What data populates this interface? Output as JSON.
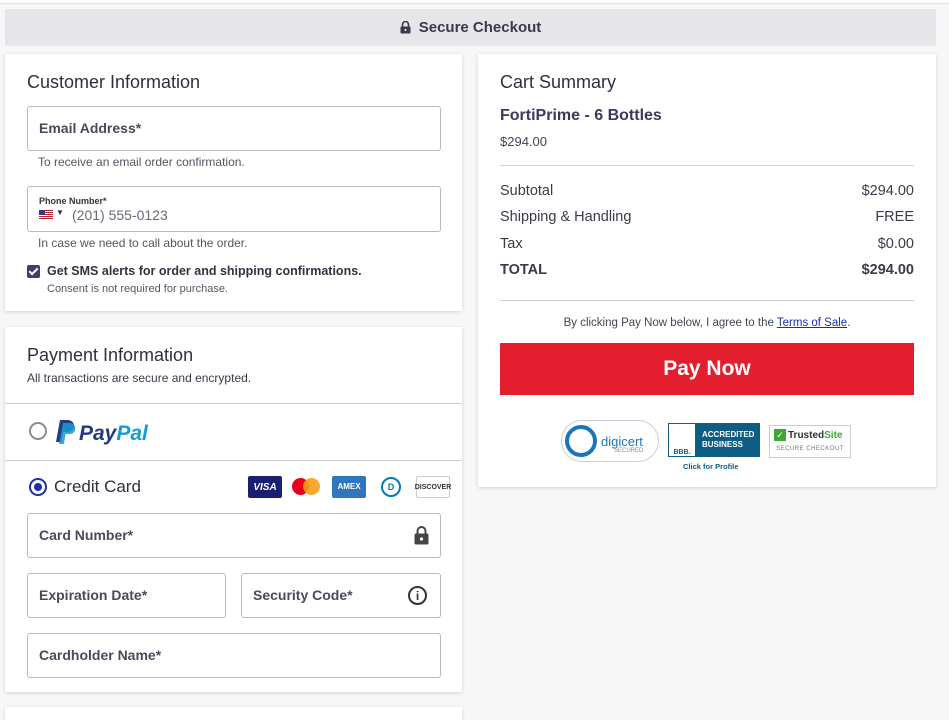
{
  "header": {
    "secure_checkout": "Secure Checkout",
    "lock_icon": "lock-icon"
  },
  "customer": {
    "title": "Customer Information",
    "email_label": "Email Address*",
    "email_helper": "To receive an email order confirmation.",
    "phone_label": "Phone Number*",
    "phone_country": "US",
    "phone_placeholder": "(201) 555-0123",
    "phone_helper": "In case we need to call about the order.",
    "sms_label": "Get SMS alerts for order and shipping confirmations.",
    "sms_checked": true,
    "consent": "Consent is not required for purchase."
  },
  "payment": {
    "title": "Payment Information",
    "subtitle": "All transactions are secure and encrypted.",
    "paypal_pay": "Pay",
    "paypal_pal": "Pal",
    "credit_card_label": "Credit Card",
    "selected_method": "credit-card",
    "card_brands": [
      "VISA",
      "Mastercard",
      "AMEX",
      "Diners Club",
      "DISCOVER"
    ],
    "card_number_label": "Card Number*",
    "expiration_label": "Expiration Date*",
    "security_code_label": "Security Code*",
    "cardholder_label": "Cardholder Name*"
  },
  "cart": {
    "title": "Cart Summary",
    "product_name": "FortiPrime - 6 Bottles",
    "product_price": "$294.00",
    "rows": [
      {
        "label": "Subtotal",
        "value": "$294.00"
      },
      {
        "label": "Shipping & Handling",
        "value": "FREE"
      },
      {
        "label": "Tax",
        "value": "$0.00"
      },
      {
        "label": "TOTAL",
        "value": "$294.00"
      }
    ],
    "terms_prefix": "By clicking Pay Now below, I agree to the",
    "terms_link": "Terms of Sale",
    "terms_suffix": ".",
    "pay_button": "Pay Now"
  },
  "badges": {
    "digicert": "digicert",
    "digicert_sub": "SECURED",
    "bbb_logo": "BBB.",
    "bbb_line1": "ACCREDITED",
    "bbb_line2": "BUSINESS",
    "bbb_sub": "Click for Profile",
    "trusted_a": "Trusted",
    "trusted_b": "Site",
    "trusted_sub": "SECURE CHECKOUT"
  },
  "colors": {
    "pay_button": "#e31e2e",
    "accent": "#1a2fa8",
    "paypal_dark": "#253b80",
    "paypal_light": "#179bd7"
  }
}
